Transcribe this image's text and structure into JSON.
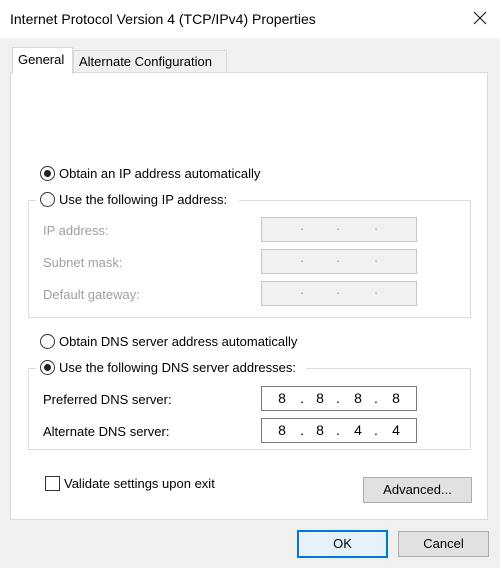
{
  "window": {
    "title": "Internet Protocol Version 4 (TCP/IPv4) Properties",
    "close_glyph": "✕"
  },
  "tabs": [
    {
      "label": "General",
      "active": true
    },
    {
      "label": "Alternate Configuration",
      "active": false
    }
  ],
  "ip_mode": {
    "auto_label": "Obtain an IP address automatically",
    "auto_selected": true,
    "manual_label": "Use the following IP address:",
    "manual_selected": false
  },
  "ip_fields": [
    {
      "label": "IP address:",
      "octets": [
        "",
        "",
        "",
        ""
      ],
      "enabled": false
    },
    {
      "label": "Subnet mask:",
      "octets": [
        "",
        "",
        "",
        ""
      ],
      "enabled": false
    },
    {
      "label": "Default gateway:",
      "octets": [
        "",
        "",
        "",
        ""
      ],
      "enabled": false
    }
  ],
  "dns_mode": {
    "auto_label": "Obtain DNS server address automatically",
    "auto_selected": false,
    "manual_label": "Use the following DNS server addresses:",
    "manual_selected": true
  },
  "dns_fields": [
    {
      "label": "Preferred DNS server:",
      "octets": [
        "8",
        "8",
        "8",
        "8"
      ],
      "enabled": true
    },
    {
      "label": "Alternate DNS server:",
      "octets": [
        "8",
        "8",
        "4",
        "4"
      ],
      "enabled": true
    }
  ],
  "validate": {
    "label": "Validate settings upon exit",
    "checked": false
  },
  "buttons": {
    "advanced": "Advanced...",
    "ok": "OK",
    "cancel": "Cancel"
  },
  "dot": "."
}
